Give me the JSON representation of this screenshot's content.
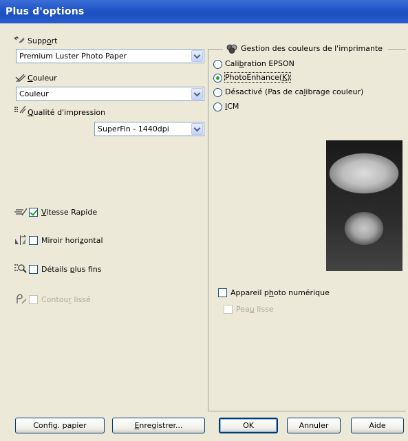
{
  "window": {
    "title": "Plus d'options"
  },
  "left": {
    "support": {
      "label_pre": "Supp",
      "label_ul": "o",
      "label_post": "rt",
      "value": "Premium Luster Photo Paper"
    },
    "couleur": {
      "label_pre": "",
      "label_ul": "C",
      "label_post": "ouleur",
      "value": "Couleur"
    },
    "qualite": {
      "label_pre": "",
      "label_ul": "Q",
      "label_post": "ualité d'impression",
      "value": "SuperFin - 1440dpi"
    },
    "vitesse": {
      "label_pre": "",
      "label_ul": "V",
      "label_post": "itesse Rapide",
      "checked": true
    },
    "miroir": {
      "label_pre": "Miroir hori",
      "label_ul": "z",
      "label_post": "ontal",
      "checked": false
    },
    "details": {
      "label_pre": "Détails ",
      "label_ul": "p",
      "label_post": "lus fins",
      "checked": false
    },
    "contour": {
      "label_pre": "Contou",
      "label_ul": "r",
      "label_post": " lissé",
      "checked": false,
      "enabled": false
    }
  },
  "right": {
    "group_title": "Gestion des couleurs de l'imprimante",
    "radios": [
      {
        "pre": "Cali",
        "ul": "b",
        "post": "ration EPSON",
        "selected": false
      },
      {
        "pre": "PhotoEnhance(",
        "ul": "K",
        "post": ")",
        "selected": true
      },
      {
        "pre": "Désactivé (Pas de ca",
        "ul": "l",
        "post": "ibrage couleur)",
        "selected": false
      },
      {
        "pre": "",
        "ul": "I",
        "post": "CM",
        "selected": false
      }
    ],
    "appareil": {
      "pre": "Appareil p",
      "ul": "h",
      "post": "oto numérique",
      "checked": false
    },
    "peau": {
      "pre": "Pea",
      "ul": "u",
      "post": " lisse",
      "checked": false,
      "enabled": false
    }
  },
  "buttons": {
    "config": "Config. papier",
    "enregistrer_ul": "E",
    "enregistrer_rest": "nregistrer...",
    "ok": "OK",
    "annuler": "Annuler",
    "aide": "Aide"
  },
  "colors": {
    "titlebar": "#2356c8",
    "background": "#ece9d8",
    "check_green": "#21a121"
  }
}
